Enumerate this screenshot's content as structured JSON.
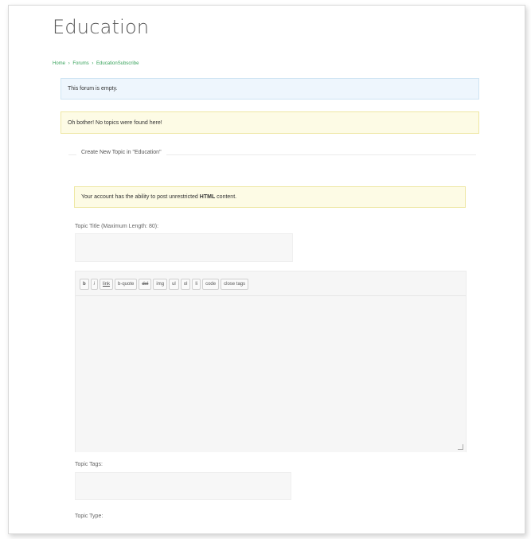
{
  "page": {
    "title": "Education"
  },
  "breadcrumb": {
    "home": "Home",
    "sep1": "›",
    "forums": "Forums",
    "sep2": "›",
    "current": "EducationSubscribe"
  },
  "notices": {
    "empty": "This forum is empty.",
    "no_topics": "Oh bother! No topics were found here!",
    "html_prefix": "Your account has the ability to post unrestricted ",
    "html_bold": "HTML",
    "html_suffix": " content."
  },
  "form": {
    "legend": "Create New Topic in \"Education\"",
    "topic_title_label": "Topic Title (Maximum Length: 80):",
    "topic_title_value": "",
    "topic_tags_label": "Topic Tags:",
    "topic_tags_value": "",
    "topic_type_label": "Topic Type:"
  },
  "editor": {
    "buttons": [
      "b",
      "i",
      "link",
      "b-quote",
      "del",
      "img",
      "ul",
      "ol",
      "li",
      "code",
      "close tags"
    ],
    "content": ""
  }
}
